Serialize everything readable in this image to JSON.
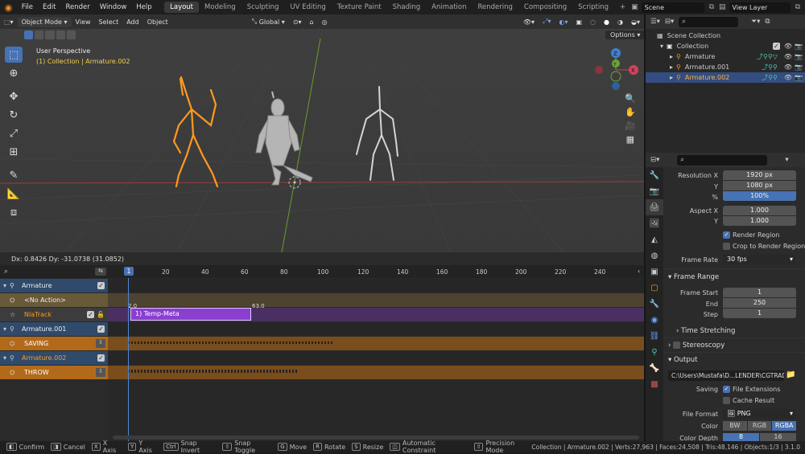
{
  "menus": [
    "File",
    "Edit",
    "Render",
    "Window",
    "Help"
  ],
  "workspaces": [
    "Layout",
    "Modeling",
    "Sculpting",
    "UV Editing",
    "Texture Paint",
    "Shading",
    "Animation",
    "Rendering",
    "Compositing",
    "Scripting"
  ],
  "add_tab": "+",
  "scene": {
    "name": "Scene"
  },
  "view_layer": {
    "name": "View Layer"
  },
  "viewport": {
    "mode": "Object Mode",
    "menus": [
      "View",
      "Select",
      "Add",
      "Object"
    ],
    "transform_orientation": "Global",
    "options_label": "Options",
    "perspective_label": "User Perspective",
    "collection_label": "(1) Collection | Armature.002",
    "hud_text": "Dx: 0.8426   Dy: -31.0738 (31.0852)",
    "gizmo": {
      "x": "X",
      "y": "Y",
      "z": "Z"
    }
  },
  "nla": {
    "ruler": [
      "20",
      "40",
      "60",
      "80",
      "100",
      "120",
      "140",
      "160",
      "180",
      "200",
      "220",
      "240"
    ],
    "current_frame": "1",
    "tracks": [
      {
        "label": "Armature",
        "kind": "object"
      },
      {
        "label": "<No Action>",
        "kind": "action"
      },
      {
        "label": "NlaTrack",
        "kind": "track"
      },
      {
        "label": "Armature.001",
        "kind": "object"
      },
      {
        "label": "SAVING",
        "kind": "action"
      },
      {
        "label": "Armature.002",
        "kind": "object"
      },
      {
        "label": "THROW",
        "kind": "action"
      }
    ],
    "strip_label": "1) Temp-Meta",
    "strip_start": "2.0",
    "strip_end": "63.0"
  },
  "outliner": {
    "root": "Scene Collection",
    "collection": "Collection",
    "items": [
      "Armature",
      "Armature.001",
      "Armature.002"
    ]
  },
  "properties": {
    "resolution_x_label": "Resolution X",
    "resolution_x": "1920 px",
    "resolution_y_label": "Y",
    "resolution_y": "1080 px",
    "percent_label": "%",
    "percent": "100%",
    "percent_fill": 1.0,
    "aspect_x_label": "Aspect X",
    "aspect_x": "1.000",
    "aspect_y_label": "Y",
    "aspect_y": "1.000",
    "render_region": "Render Region",
    "crop_region": "Crop to Render Region",
    "frame_rate_label": "Frame Rate",
    "frame_rate": "30 fps",
    "frame_range": "Frame Range",
    "frame_start_label": "Frame Start",
    "frame_start": "1",
    "end_label": "End",
    "end": "250",
    "step_label": "Step",
    "step": "1",
    "time_stretching": "Time Stretching",
    "stereoscopy": "Stereoscopy",
    "output": "Output",
    "output_path": "C:\\Users\\Mustafa\\D...LENDER\\CGTRADE\\",
    "saving_label": "Saving",
    "file_extensions": "File Extensions",
    "cache_result": "Cache Result",
    "file_format_label": "File Format",
    "file_format": "PNG",
    "color_label": "Color",
    "color_options": [
      "BW",
      "RGB",
      "RGBA"
    ],
    "color_depth_label": "Color Depth",
    "color_depth_options": [
      "8",
      "16"
    ]
  },
  "status": {
    "items": [
      {
        "key": "",
        "label": "Confirm"
      },
      {
        "key": "",
        "label": "Cancel"
      },
      {
        "key": "X",
        "label": "X Axis"
      },
      {
        "key": "Y",
        "label": "Y Axis"
      },
      {
        "key": "Ctrl",
        "label": "Snap Invert"
      },
      {
        "key": "",
        "label": "Snap Toggle"
      },
      {
        "key": "G",
        "label": "Move"
      },
      {
        "key": "R",
        "label": "Rotate"
      },
      {
        "key": "S",
        "label": "Resize"
      },
      {
        "key": "",
        "label": "Automatic Constraint"
      },
      {
        "key": "",
        "label": "Precision Mode"
      }
    ],
    "right": "Collection | Armature.002 | Verts:27,963 | Faces:24,508 | Tris:48,146 | Objects:1/3 | 3.1.0"
  },
  "colors": {
    "accent": "#4772b3",
    "selection_orange": "#ff9a1f",
    "strip_purple": "#8a3fcf",
    "active_track": "#9b8a3a"
  }
}
